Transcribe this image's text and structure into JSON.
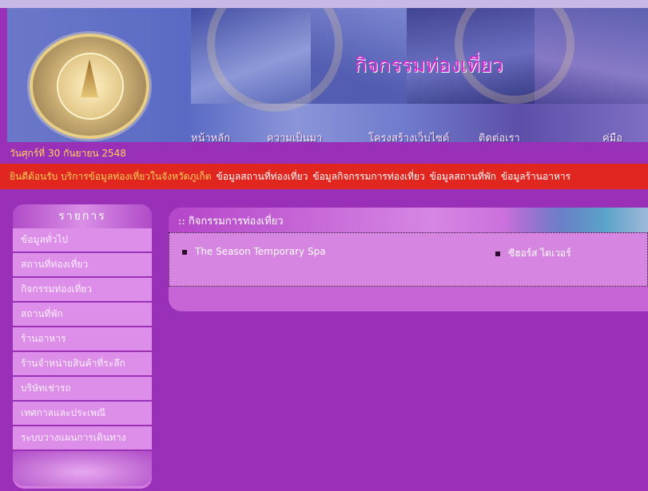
{
  "header": {
    "title": "กิจกรรมท่องเที่ยว",
    "nav": [
      "หน้าหลัก",
      "ความเป็นมา",
      "โครงสร้างเว็บไซต์",
      "ติดต่อเรา",
      "คู่มือ"
    ]
  },
  "date": "วันศุกร์ที่ 30 กันยายน 2548",
  "marquee": {
    "lead": "ยินดีต้อนรับ บริการข้อมูลท่องเที่ยวในจังหวัดภูเก็ต",
    "links": [
      "ข้อมูลสถานที่ท่องเที่ยว",
      "ข้อมูลกิจกรรมการท่องเที่ยว",
      "ข้อมูลสถานที่พัก",
      "ข้อมูลร้านอาหาร"
    ]
  },
  "sidebar": {
    "title": "รายการ",
    "items": [
      "ข้อมูลทั่วไป",
      "สถานที่ท่องเที่ยว",
      "กิจกรรมท่องเที่ยว",
      "สถานที่พัก",
      "ร้านอาหาร",
      "ร้านจำหน่ายสินค้าที่ระลึก",
      "บริษัทเช่ารถ",
      "เทศกาลและประเพณี",
      "ระบบวางแผนการเดินทาง"
    ]
  },
  "content": {
    "title": ":: กิจกรรมการท่องเที่ยว",
    "items": [
      "The Season Temporary Spa",
      "ซีฮอร์ส ไดเวอร์"
    ]
  },
  "colors": {
    "page_bg": "#9a2fb8",
    "marquee_bg": "#e0261f",
    "date_text": "#ffd25a",
    "banner_title": "#d22ad1"
  },
  "icons": [
    "bullet-square-icon"
  ]
}
